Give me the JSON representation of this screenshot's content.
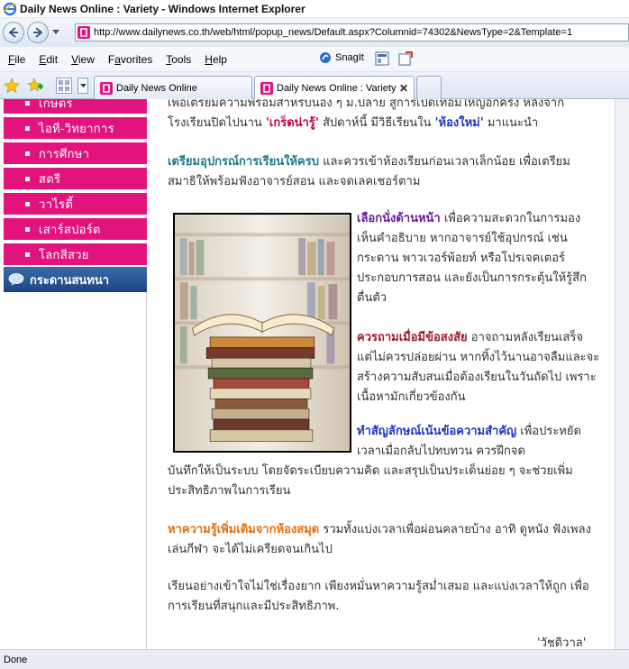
{
  "window": {
    "title": "Daily News Online : Variety - Windows Internet Explorer"
  },
  "address": {
    "url": "http://www.dailynews.co.th/web/html/popup_news/Default.aspx?Columnid=74302&NewsType=2&Template=1"
  },
  "menu": {
    "file": "File",
    "file_ul": "F",
    "edit": "Edit",
    "edit_ul": "E",
    "view": "View",
    "view_ul": "V",
    "favorites": "Favorites",
    "favorites_ul": "a",
    "tools": "Tools",
    "tools_ul": "T",
    "help": "Help",
    "help_ul": "H"
  },
  "toolbar": {
    "snagit_label": "SnagIt"
  },
  "tabs": [
    {
      "label": "Daily News Online"
    },
    {
      "label": "Daily News Online : Variety"
    }
  ],
  "sidebar": {
    "items": [
      {
        "label": "เกษตร"
      },
      {
        "label": "ไอที-วิทยาการ"
      },
      {
        "label": "การศึกษา"
      },
      {
        "label": "สตรี"
      },
      {
        "label": "วาไรตี้"
      },
      {
        "label": "เสาร์สปอร์ต"
      },
      {
        "label": "โลกสีสวย"
      }
    ],
    "board_label": "กระดานสนทนา"
  },
  "article": {
    "intro_line1_a": "เพื่อเตรียมความพร้อมสำหรับน้อง ๆ ม.ปลาย สู่การเปิดเทอมใหญ่อีกครั้ง หลังจาก",
    "intro_line2_a": "โรงเรียนปิดไปนาน ",
    "intro_hl1": "'เกร็ดน่ารู้'",
    "intro_line2_b": " สัปดาห์นี้ มีวิธีเรียนใน ",
    "intro_hl2": "'ห้องใหม่'",
    "intro_line2_c": " มาแนะนำ",
    "p1_hl": "เตรียมอุปกรณ์การเรียนให้ครบ",
    "p1_text": " และควรเข้าห้องเรียนก่อนเวลาเล็กน้อย เพื่อเตรียมสมาธิให้พร้อมฟังอาจารย์สอน และจดเลคเชอร์ตาม",
    "p2_hl": "เลือกนั่งด้านหน้า",
    "p2_text": " เพื่อความสะดวกในการมองเห็นคำอธิบาย หากอาจารย์ใช้อุปกรณ์ เช่น กระดาน พาวเวอร์พ้อยท์ หรือโปรเจคเตอร์ ประกอบการสอน และยังเป็นการกระตุ้นให้รู้สึกตื่นตัว",
    "p3_hl": "ควรถามเมื่อมีข้อสงสัย",
    "p3_text": " อาจถามหลังเรียนเสร็จ แต่ไม่ควรปล่อยผ่าน หากทิ้งไว้นานอาจลืมและจะสร้างความสับสนเมื่อต้องเรียนในวันถัดไป เพราะเนื้อหามักเกี่ยวข้องกัน",
    "p4_hl": "ทำสัญลักษณ์เน้นข้อความสำคัญ",
    "p4_text_a": " เพื่อประหยัดเวลาเมื่อกลับไปทบทวน ควรฝึกจด",
    "p4_text_b": "บันทึกให้เป็นระบบ โดยจัดระเบียบความคิด และสรุปเป็นประเด็นย่อย ๆ จะช่วยเพิ่มประสิทธิภาพในการเรียน",
    "p5_hl": "หาความรู้เพิ่มเติมจากห้องสมุด",
    "p5_text": " รวมทั้งแบ่งเวลาเพื่อผ่อนคลายบ้าง อาทิ ดูหนัง ฟังเพลง เล่นกีฬา จะได้ไม่เครียดจนเกินไป",
    "p6_text": "เรียนอย่างเข้าใจไม่ใช่เรื่องยาก เพียงหมั่นหาความรู้สม่ำเสมอ และแบ่งเวลาให้ถูก เพื่อการเรียนที่สนุกและมีประสิทธิภาพ.",
    "byline": "'วัชดิวาล'"
  },
  "status": {
    "text": "Done"
  },
  "colors": {
    "sidebar_bg": "#e3137e",
    "board_bg": "#1c4582"
  }
}
